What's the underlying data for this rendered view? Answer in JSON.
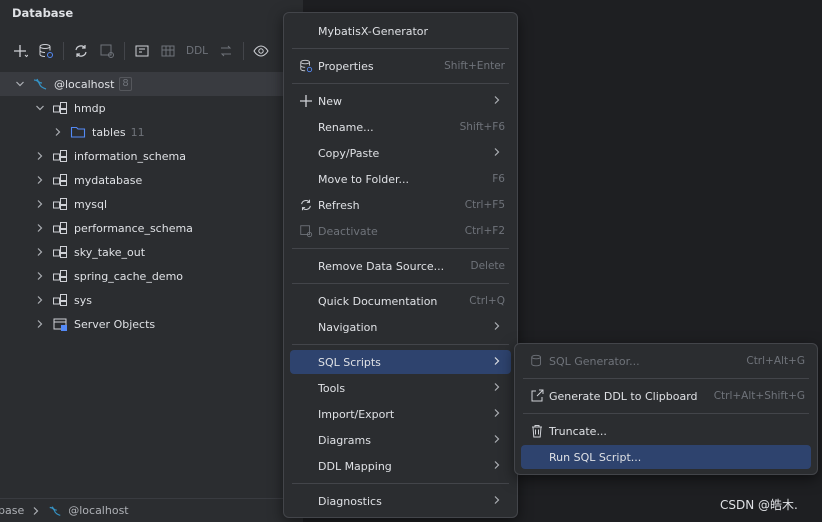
{
  "panel": {
    "title": "Database"
  },
  "toolbar": {
    "ddl_label": "DDL"
  },
  "tree": {
    "root": {
      "label": "@localhost",
      "count": "8"
    },
    "hmdp": {
      "label": "hmdp"
    },
    "tables": {
      "label": "tables",
      "count": "11"
    },
    "schemas": [
      "information_schema",
      "mydatabase",
      "mysql",
      "performance_schema",
      "sky_take_out",
      "spring_cache_demo",
      "sys"
    ],
    "server_objects": "Server Objects"
  },
  "breadcrumb": {
    "part1": "base",
    "part2": "@localhost"
  },
  "menu": {
    "mybatisx": "MybatisX-Generator",
    "properties": {
      "label": "Properties",
      "shortcut": "Shift+Enter"
    },
    "new": "New",
    "rename": {
      "label": "Rename...",
      "shortcut": "Shift+F6"
    },
    "copy_paste": "Copy/Paste",
    "move_to_folder": {
      "label": "Move to Folder...",
      "shortcut": "F6"
    },
    "refresh": {
      "label": "Refresh",
      "shortcut": "Ctrl+F5"
    },
    "deactivate": {
      "label": "Deactivate",
      "shortcut": "Ctrl+F2"
    },
    "remove_data_source": {
      "label": "Remove Data Source...",
      "shortcut": "Delete"
    },
    "quick_documentation": {
      "label": "Quick Documentation",
      "shortcut": "Ctrl+Q"
    },
    "navigation": "Navigation",
    "sql_scripts": "SQL Scripts",
    "tools": "Tools",
    "import_export": "Import/Export",
    "diagrams": "Diagrams",
    "ddl_mapping": "DDL Mapping",
    "diagnostics": "Diagnostics"
  },
  "submenu": {
    "sql_generator": {
      "label": "SQL Generator...",
      "shortcut": "Ctrl+Alt+G"
    },
    "generate_ddl": {
      "label": "Generate DDL to Clipboard",
      "shortcut": "Ctrl+Alt+Shift+G"
    },
    "truncate": {
      "label": "Truncate..."
    },
    "run_sql_script": {
      "label": "Run SQL Script..."
    }
  },
  "watermark": "CSDN @皓木.",
  "colors": {
    "panel_bg": "#2b2d30",
    "editor_bg": "#1e1f22",
    "menu_active": "#2e436e",
    "folder_blue": "#548af7",
    "mysql_blue": "#3592c4"
  }
}
